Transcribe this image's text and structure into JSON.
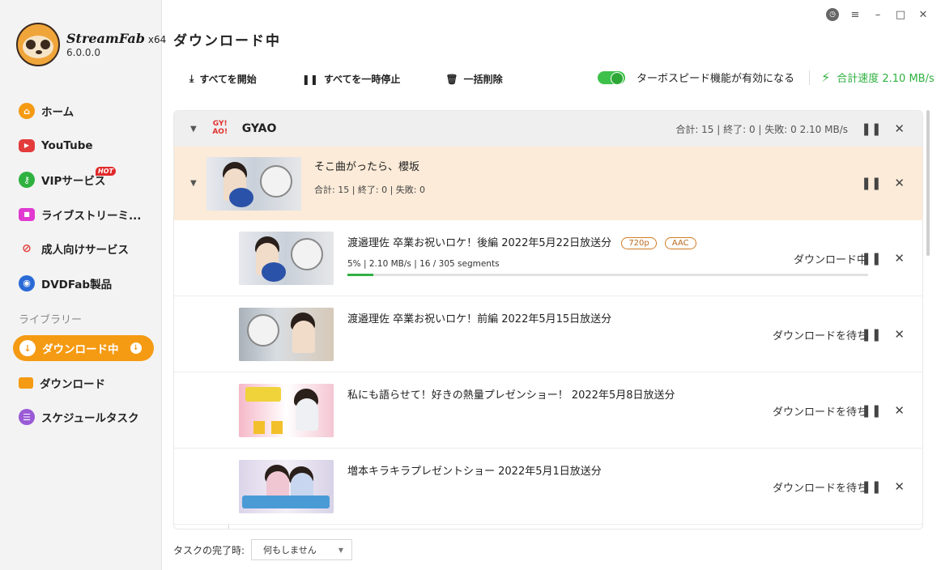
{
  "app": {
    "brand": "StreamFab",
    "arch": "x64",
    "version": "6.0.0.0"
  },
  "window_controls": {
    "history_icon": "clock-icon",
    "menu": "≡",
    "minimize": "–",
    "maximize": "□",
    "close": "✕"
  },
  "sidebar": {
    "items": [
      {
        "label": "ホーム",
        "icon": "home-icon",
        "color": "#f59a13",
        "glyph": "⌂"
      },
      {
        "label": "YouTube",
        "icon": "youtube-icon",
        "color": "#e33b3b",
        "glyph": "▶"
      },
      {
        "label": "VIPサービス",
        "icon": "key-icon",
        "color": "#2fb140",
        "glyph": "⚷",
        "badge": "HOT"
      },
      {
        "label": "ライブストリーミ...",
        "icon": "camera-icon",
        "color": "#e03ad0",
        "glyph": "■"
      },
      {
        "label": "成人向けサービス",
        "icon": "adult-icon",
        "color": "#e33b3b",
        "glyph": "🔞"
      },
      {
        "label": "DVDFab製品",
        "icon": "dvdfab-icon",
        "color": "#2a6ad6",
        "glyph": "◉"
      }
    ],
    "library_label": "ライブラリー",
    "library": [
      {
        "label": "ダウンロード中",
        "icon": "download-icon",
        "glyph": "↓",
        "active": true
      },
      {
        "label": "ダウンロード",
        "icon": "folder-icon",
        "glyph": "▬",
        "color": "#f59a13"
      },
      {
        "label": "スケジュールタスク",
        "icon": "schedule-icon",
        "glyph": "☰",
        "color": "#9a5ad6"
      }
    ]
  },
  "header": {
    "title": "ダウンロード中",
    "start_all": "すべてを開始",
    "pause_all": "すべてを一時停止",
    "delete_all": "一括削除",
    "turbo_label": "ターボスピード機能が有効になる",
    "turbo_on": true,
    "total_speed": "合計速度 2.10 MB/s"
  },
  "group": {
    "name": "GYAO",
    "logo_text_top": "GY!",
    "logo_text_bottom": "AO!",
    "stats": "合計: 15 | 終了: 0 | 失敗: 0   2.10 MB/s",
    "subgroup": {
      "title": "そこ曲がったら、櫻坂",
      "stats": "合計: 15 | 終了: 0 | 失敗: 0"
    },
    "tasks": [
      {
        "title": "渡邉理佐 卒業お祝いロケ！後編 2022年5月22日放送分",
        "tags": [
          "720p",
          "AAC"
        ],
        "progress_text": "5%  |  2.10 MB/s  |  16 / 305 segments",
        "progress": 0.05,
        "status": "ダウンロード中"
      },
      {
        "title": "渡邉理佐 卒業お祝いロケ！前編 2022年5月15日放送分",
        "tags": [],
        "progress_text": "",
        "progress": null,
        "status": "ダウンロードを待ち"
      },
      {
        "title": "私にも語らせて！好きの熱量プレゼンショー！ 2022年5月8日放送分",
        "tags": [],
        "progress_text": "",
        "progress": null,
        "status": "ダウンロードを待ち"
      },
      {
        "title": "増本キラキラプレゼントショー 2022年5月1日放送分",
        "tags": [],
        "progress_text": "",
        "progress": null,
        "status": "ダウンロードを待ち"
      }
    ]
  },
  "footer": {
    "label": "タスクの完了時:",
    "select_value": "何もしません"
  },
  "colors": {
    "accent": "#f59a13",
    "green": "#2fb140",
    "subgroup_bg": "#fbebd8"
  }
}
